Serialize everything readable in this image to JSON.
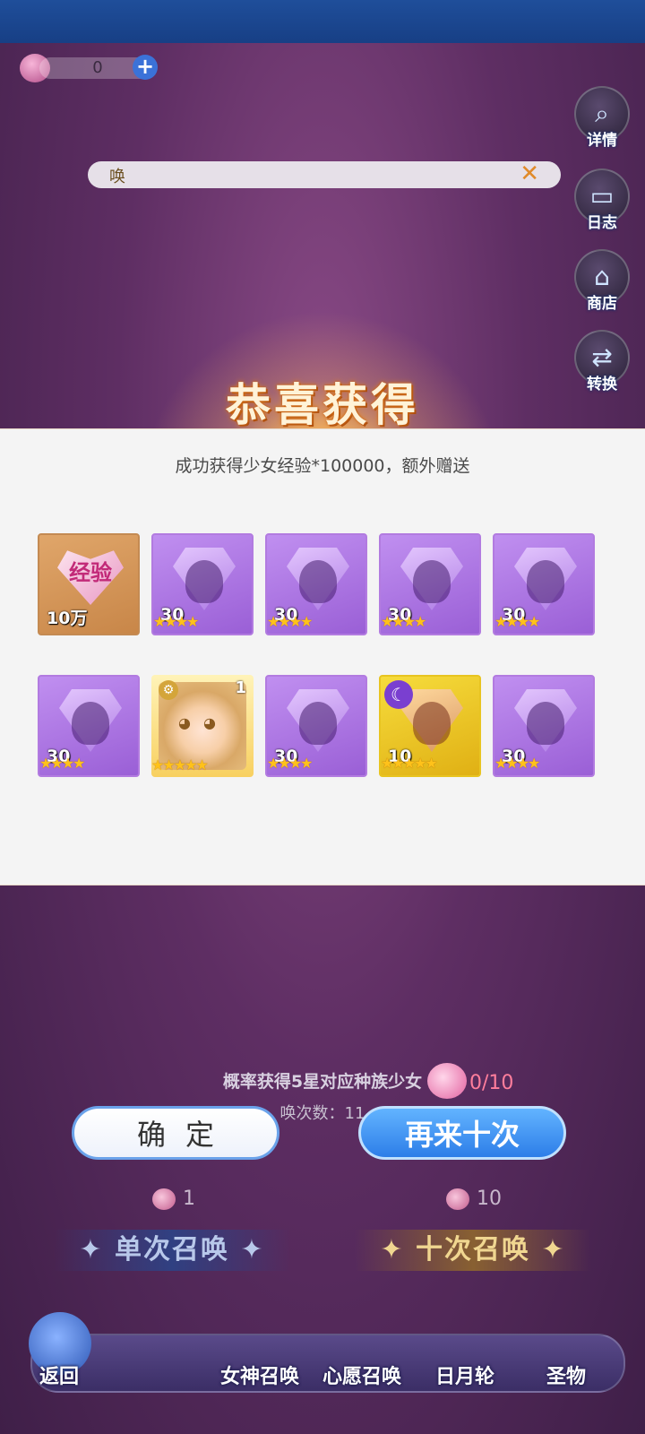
{
  "header": {
    "currency_value": "0",
    "plus_label": "+"
  },
  "side_buttons": [
    {
      "label": "详情",
      "icon": "magnifier-icon"
    },
    {
      "label": "日志",
      "icon": "book-icon"
    },
    {
      "label": "商店",
      "icon": "shop-icon"
    },
    {
      "label": "转换",
      "icon": "exchange-icon"
    }
  ],
  "search": {
    "value": "唤",
    "clear_label": "✕"
  },
  "reward_dialog": {
    "title": "恭喜获得",
    "message": "成功获得少女经验*100000，额外赠送",
    "items": [
      {
        "type": "exp",
        "label": "经验",
        "count": "10万"
      },
      {
        "type": "shard",
        "count": "30",
        "stars": "★★★★"
      },
      {
        "type": "shard",
        "count": "30",
        "stars": "★★★★"
      },
      {
        "type": "shard",
        "count": "30",
        "stars": "★★★★"
      },
      {
        "type": "shard",
        "count": "30",
        "stars": "★★★★"
      },
      {
        "type": "shard",
        "count": "30",
        "stars": "★★★★"
      },
      {
        "type": "character",
        "count": "1",
        "stars": "★★★★★"
      },
      {
        "type": "shard",
        "count": "30",
        "stars": "★★★★"
      },
      {
        "type": "gold-shard",
        "count": "10",
        "stars": "★★★★★"
      },
      {
        "type": "shard",
        "count": "30",
        "stars": "★★★★"
      }
    ]
  },
  "hint": {
    "line1": "概率获得5星对应种族少女",
    "line2": "唤次数：11",
    "ticket_count": "0/10"
  },
  "buttons": {
    "confirm": "确定",
    "again": "再来十次"
  },
  "summon": {
    "single_cost": "1",
    "ten_cost": "10",
    "single_label": "✦ 单次召唤 ✦",
    "ten_label": "✦ 十次召唤 ✦"
  },
  "nav": {
    "back": "返回",
    "items": [
      "女神召唤",
      "心愿召唤",
      "日月轮",
      "圣物"
    ]
  },
  "colors": {
    "accent_blue": "#2d7ee8",
    "star_gold": "#ffc21a",
    "shard_purple": "#9a5fd6"
  }
}
